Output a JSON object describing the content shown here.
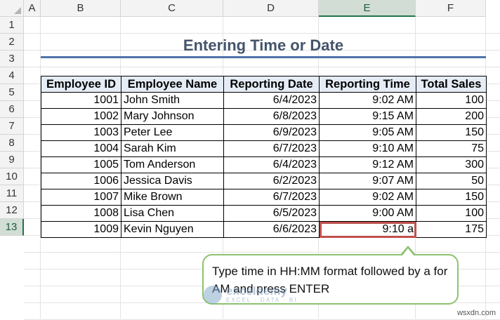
{
  "columns": [
    "A",
    "B",
    "C",
    "D",
    "E",
    "F"
  ],
  "active_column": "E",
  "rows": [
    "1",
    "2",
    "3",
    "4",
    "5",
    "6",
    "7",
    "8",
    "9",
    "10",
    "11",
    "12",
    "13"
  ],
  "active_row": "13",
  "title": "Entering Time or Date",
  "table": {
    "headers": [
      "Employee ID",
      "Employee Name",
      "Reporting Date",
      "Reporting Time",
      "Total Sales"
    ],
    "rows": [
      [
        "1001",
        "John Smith",
        "6/4/2023",
        "9:02 AM",
        "100"
      ],
      [
        "1002",
        "Mary Johnson",
        "6/8/2023",
        "9:15 AM",
        "200"
      ],
      [
        "1003",
        "Peter Lee",
        "6/9/2023",
        "9:05 AM",
        "150"
      ],
      [
        "1004",
        "Sarah Kim",
        "6/7/2023",
        "9:10 AM",
        "75"
      ],
      [
        "1005",
        "Tom Anderson",
        "6/4/2023",
        "9:12 AM",
        "300"
      ],
      [
        "1006",
        "Jessica Davis",
        "6/2/2023",
        "9:07 AM",
        "50"
      ],
      [
        "1007",
        "Mike Brown",
        "6/7/2023",
        "9:02 AM",
        "150"
      ],
      [
        "1008",
        "Lisa Chen",
        "6/5/2023",
        "9:00 AM",
        "100"
      ],
      [
        "1009",
        "Kevin Nguyen",
        "6/6/2023",
        "9:10 a",
        "175"
      ]
    ]
  },
  "callout": "Type time in HH:MM format followed by a for AM and press ENTER",
  "watermark": {
    "name": "exceldemy",
    "tagline": "EXCEL · DATA · BI"
  },
  "site": "wsxdn.com",
  "colors": {
    "accent": "#217346",
    "title": "#44546a",
    "selection": "#c0504d",
    "callout_border": "#8dc26f",
    "header_fill": "#e6ecf5"
  }
}
